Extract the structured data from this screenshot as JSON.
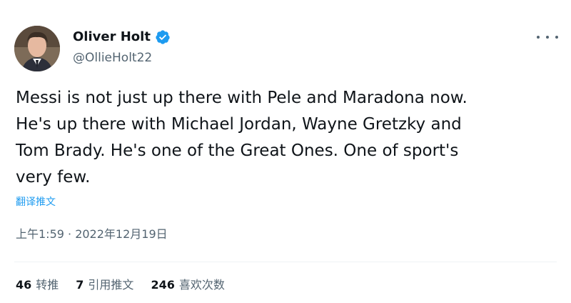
{
  "author": {
    "display_name": "Oliver Holt",
    "handle": "@OllieHolt22",
    "verified": true,
    "verified_color": "#1d9bf0"
  },
  "tweet": {
    "text": "Messi is not just up there with Pele and Maradona now.\nHe's up there with Michael Jordan, Wayne Gretzky and\nTom Brady. He's one of the Great Ones. One of sport's\nvery few.",
    "translate_label": "翻译推文",
    "timestamp": "上午1:59 · 2022年12月19日"
  },
  "stats": {
    "retweets": {
      "count": "46",
      "label": "转推"
    },
    "quotes": {
      "count": "7",
      "label": "引用推文"
    },
    "likes": {
      "count": "246",
      "label": "喜欢次数"
    }
  },
  "icons": {
    "more": "more-horizontal-icon",
    "verified": "verified-badge-icon"
  },
  "colors": {
    "text_primary": "#0f1419",
    "text_secondary": "#536471",
    "link": "#1d9bf0",
    "divider": "#eff3f4"
  }
}
